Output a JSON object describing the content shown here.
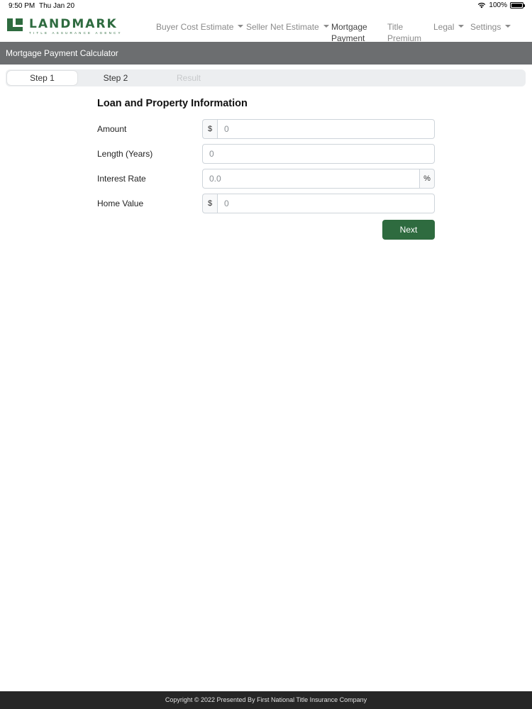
{
  "status_bar": {
    "time": "9:50 PM",
    "date": "Thu Jan 20",
    "battery": "100%"
  },
  "brand": {
    "name": "LANDMARK",
    "tagline": "TITLE ASSURANCE AGENCY",
    "color": "#2e6b3f"
  },
  "nav": {
    "items": [
      {
        "label": "Buyer Cost Estimate",
        "dropdown": true
      },
      {
        "label": "Seller Net Estimate",
        "dropdown": true
      },
      {
        "label_line1": "Mortgage",
        "label_line2": "Payment",
        "active": true
      },
      {
        "label_line1": "Title",
        "label_line2": "Premium"
      },
      {
        "label": "Legal",
        "dropdown": true
      },
      {
        "label": "Settings",
        "dropdown": true
      }
    ]
  },
  "page": {
    "title": "Mortgage Payment Calculator",
    "title_bar_color": "#6c6e70"
  },
  "steps": [
    {
      "label": "Step 1",
      "state": "active"
    },
    {
      "label": "Step 2",
      "state": "enabled"
    },
    {
      "label": "Result",
      "state": "disabled"
    }
  ],
  "form": {
    "heading": "Loan and Property Information",
    "fields": {
      "amount": {
        "label": "Amount",
        "prefix": "$",
        "placeholder": "0"
      },
      "length": {
        "label": "Length (Years)",
        "placeholder": "0"
      },
      "interest_rate": {
        "label": "Interest Rate",
        "suffix": "%",
        "placeholder": "0.0"
      },
      "home_value": {
        "label": "Home Value",
        "prefix": "$",
        "placeholder": "0"
      }
    },
    "next_label": "Next"
  },
  "footer": {
    "text": "Copyright © 2022 Presented By First National Title Insurance Company"
  }
}
